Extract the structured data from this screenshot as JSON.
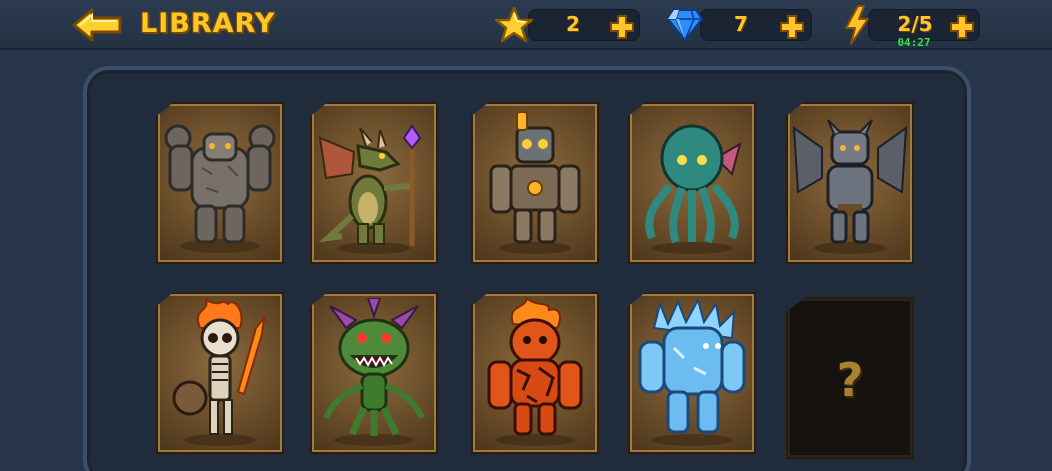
{
  "header": {
    "title": "LIBRARY"
  },
  "resources": {
    "stars": {
      "value": "2",
      "icon": "star-icon"
    },
    "gems": {
      "value": "7",
      "icon": "diamond-icon"
    },
    "energy": {
      "value": "2/5",
      "icon": "lightning-icon",
      "timer": "04:27"
    }
  },
  "cards": [
    {
      "name": "Stone Golem",
      "locked": false
    },
    {
      "name": "Dragon Mage",
      "locked": false
    },
    {
      "name": "Steam Robot",
      "locked": false
    },
    {
      "name": "Kraken",
      "locked": false
    },
    {
      "name": "Gargoyle",
      "locked": false
    },
    {
      "name": "Flame Skeleton",
      "locked": false
    },
    {
      "name": "Plant Monster",
      "locked": false
    },
    {
      "name": "Lava Elemental",
      "locked": false
    },
    {
      "name": "Ice Golem",
      "locked": false
    },
    {
      "name": "Locked",
      "locked": true,
      "label": "?"
    }
  ],
  "colors": {
    "accent": "#ffc62a",
    "timer": "#35e04a",
    "background": "#27354a"
  }
}
